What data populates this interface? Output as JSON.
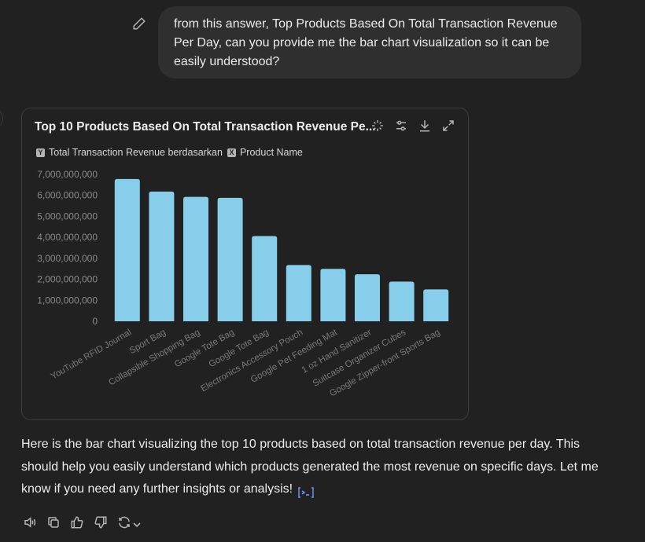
{
  "user_message": {
    "lines": [
      "from this answer, Top Products Based On Total Transaction Revenue",
      "Per Day, can you provide me the bar chart visualization so it can be",
      "easily understood?"
    ]
  },
  "chart_card": {
    "title": "Top 10 Products Based On Total Transaction Revenue Pe...",
    "legend": {
      "y_tag": "Y",
      "y_label": "Total Transaction Revenue berdasarkan",
      "x_tag": "X",
      "x_label": "Product Name"
    },
    "tools": [
      "sparkle-icon",
      "sliders-icon",
      "download-icon",
      "expand-icon"
    ]
  },
  "chart_data": {
    "type": "bar",
    "title": "Top 10 Products Based On Total Transaction Revenue Pe...",
    "categories": [
      "YouTube RFID Journal",
      "Sport Bag",
      "Collapsible Shopping Bag",
      "Google Tote Bag",
      "Google Tote Bag",
      "Electronics Accessory Pouch",
      "Google Pet Feeding Mat",
      "1 oz Hand Sanitizer",
      "Suitcase Organizer Cubes",
      "Google Zipper-front Sports Bag"
    ],
    "values": [
      6780000000,
      6180000000,
      5930000000,
      5880000000,
      4060000000,
      2680000000,
      2500000000,
      2240000000,
      1890000000,
      1520000000
    ],
    "ylim": [
      0,
      7000000000
    ],
    "yticks": [
      {
        "value": 0,
        "label": "0"
      },
      {
        "value": 1000000000,
        "label": "1,000,000,000"
      },
      {
        "value": 2000000000,
        "label": "2,000,000,000"
      },
      {
        "value": 3000000000,
        "label": "3,000,000,000"
      },
      {
        "value": 4000000000,
        "label": "4,000,000,000"
      },
      {
        "value": 5000000000,
        "label": "5,000,000,000"
      },
      {
        "value": 6000000000,
        "label": "6,000,000,000"
      },
      {
        "value": 7000000000,
        "label": "7,000,000,000"
      }
    ],
    "bar_color": "#87ceeb",
    "grid": false
  },
  "assistant_message": {
    "text": "Here is the bar chart visualizing the top 10 products based on total transaction revenue per day. This should help you easily understand which products generated the most revenue on specific days. Let me know if you need any further insights or analysis!"
  },
  "colors": {
    "background": "#212121",
    "bubble": "#2f2f2f",
    "text": "#ececec",
    "muted": "#b4b4b4",
    "link": "#6c9cff"
  },
  "message_actions": [
    "speaker-icon",
    "copy-icon",
    "thumbs-up-icon",
    "thumbs-down-icon",
    "regenerate-icon",
    "chevron-down-icon"
  ]
}
